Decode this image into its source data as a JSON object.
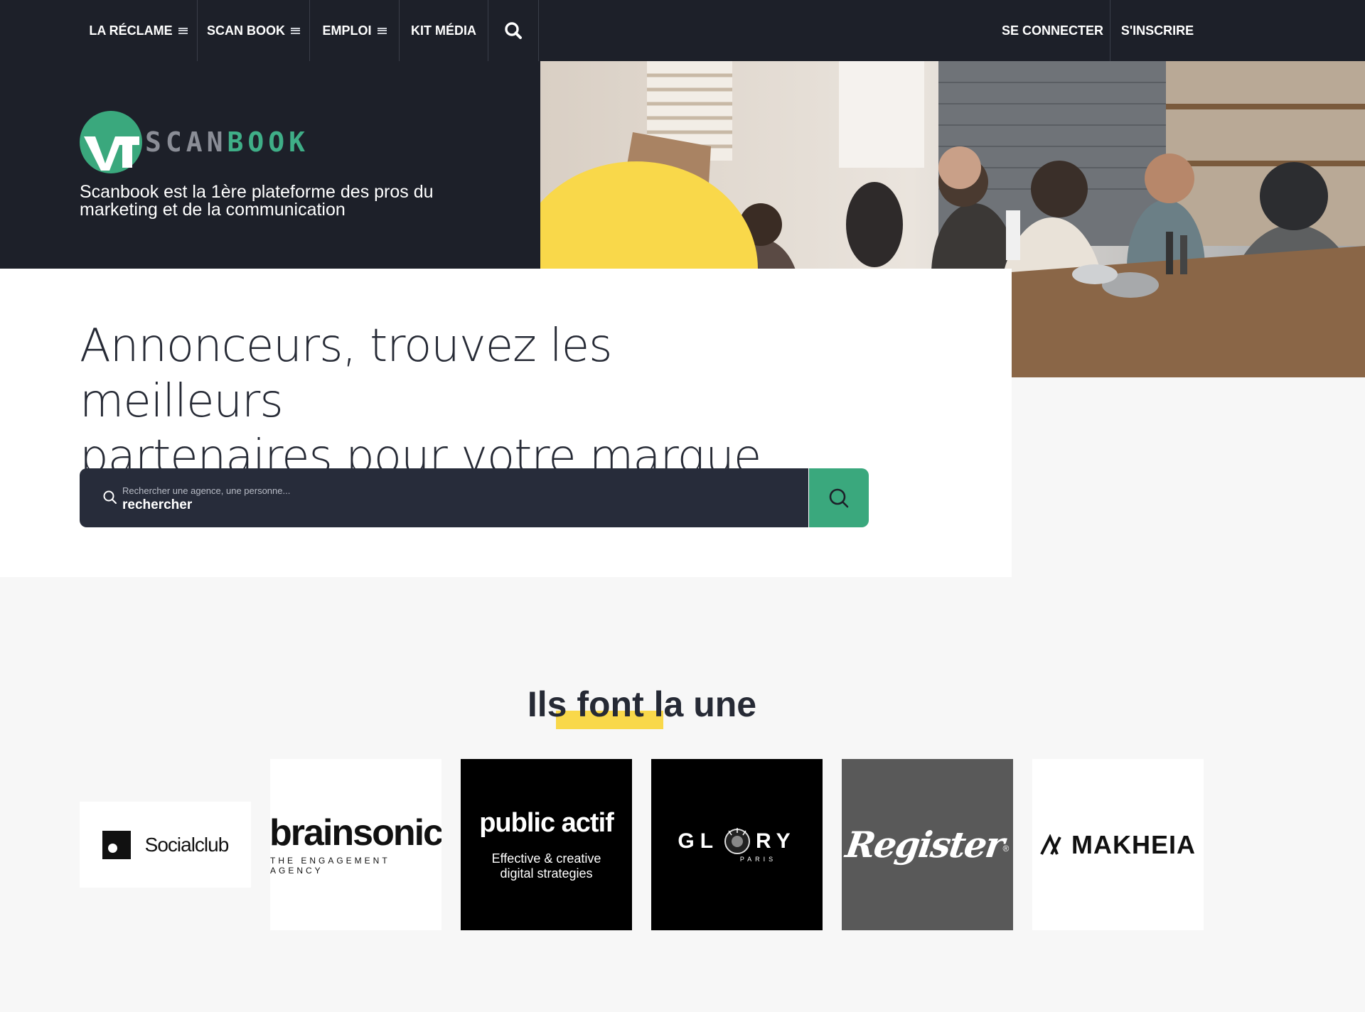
{
  "nav": {
    "left": [
      {
        "label": "LA RÉCLAME",
        "menu": true
      },
      {
        "label": "SCAN BOOK",
        "menu": true
      },
      {
        "label": "EMPLOI",
        "menu": true
      },
      {
        "label": "KIT MÉDIA",
        "menu": false
      }
    ],
    "search_icon": "search-icon",
    "login": "SE CONNECTER",
    "signup": "S'INSCRIRE"
  },
  "brand": {
    "logo_part1": "SCAN",
    "logo_part2": "BOOK",
    "tagline": "Scanbook est la 1ère plateforme des pros du marketing et de la communication"
  },
  "hero": {
    "headline_line1": "Annonceurs, trouvez les meilleurs",
    "headline_line2": "partenaires pour votre marque !"
  },
  "search": {
    "placeholder": "Rechercher une agence, une personne...",
    "value": "rechercher",
    "button_icon": "search-icon"
  },
  "featured": {
    "title": "Ils font la une",
    "agencies": [
      {
        "name": "Socialclub"
      },
      {
        "name": "brainsonic",
        "subtitle": "THE ENGAGEMENT AGENCY"
      },
      {
        "name": "public actif",
        "subtitle_line1": "Effective & creative",
        "subtitle_line2": "digital strategies"
      },
      {
        "name_left": "GL",
        "name_right": "RY",
        "subtitle": "PARIS"
      },
      {
        "name": "Register",
        "mark": "®"
      },
      {
        "name": "MAKHEIA"
      }
    ]
  },
  "colors": {
    "dark": "#1d2029",
    "green": "#3aa87d",
    "yellow": "#f9d84a",
    "search_bar": "#272c3a"
  }
}
